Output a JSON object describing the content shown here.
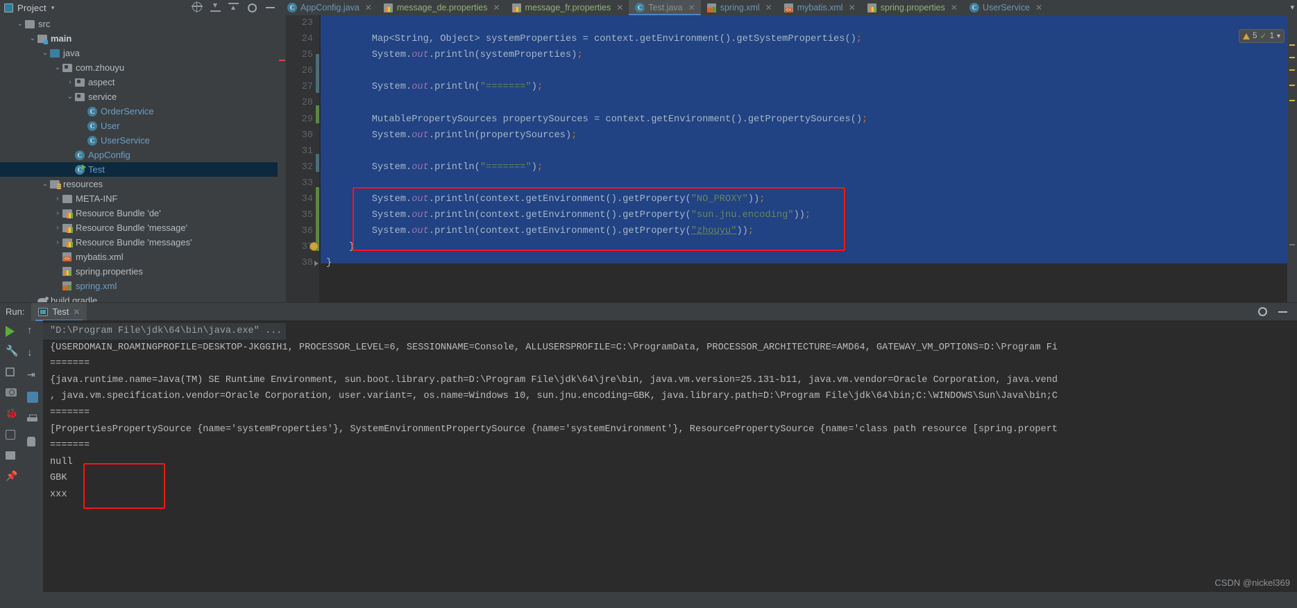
{
  "project_panel": {
    "title": "Project",
    "caret": "▾",
    "icons": [
      "project-window-icon",
      "locate-icon",
      "collapse-all-icon",
      "expand-all-icon"
    ],
    "tree": [
      {
        "indent": 1,
        "twist": "⌄",
        "icon": "folder-icon",
        "label": "src",
        "style": "plain"
      },
      {
        "indent": 2,
        "twist": "⌄",
        "icon": "source-folder-icon",
        "label": "main",
        "style": "bold"
      },
      {
        "indent": 3,
        "twist": "⌄",
        "icon": "java-folder-icon",
        "label": "java",
        "style": "plain"
      },
      {
        "indent": 4,
        "twist": "⌄",
        "icon": "package-icon",
        "label": "com.zhouyu",
        "style": "plain"
      },
      {
        "indent": 5,
        "twist": "›",
        "icon": "package-icon",
        "label": "aspect",
        "style": "plain"
      },
      {
        "indent": 5,
        "twist": "⌄",
        "icon": "package-icon",
        "label": "service",
        "style": "plain"
      },
      {
        "indent": 6,
        "twist": "",
        "icon": "java-class-icon",
        "label": "OrderService",
        "style": "blue"
      },
      {
        "indent": 6,
        "twist": "",
        "icon": "java-class-icon",
        "label": "User",
        "style": "blue"
      },
      {
        "indent": 6,
        "twist": "",
        "icon": "java-class-icon",
        "label": "UserService",
        "style": "blue"
      },
      {
        "indent": 5,
        "twist": "",
        "icon": "java-class-icon",
        "label": "AppConfig",
        "style": "blue"
      },
      {
        "indent": 5,
        "twist": "",
        "icon": "runnable-class-icon",
        "label": "Test",
        "style": "blue",
        "selected": true
      },
      {
        "indent": 3,
        "twist": "⌄",
        "icon": "resources-folder-icon",
        "label": "resources",
        "style": "plain"
      },
      {
        "indent": 4,
        "twist": "›",
        "icon": "folder-icon",
        "label": "META-INF",
        "style": "plain"
      },
      {
        "indent": 4,
        "twist": "›",
        "icon": "bundle-icon",
        "label": "Resource Bundle 'de'",
        "style": "plain"
      },
      {
        "indent": 4,
        "twist": "›",
        "icon": "bundle-icon",
        "label": "Resource Bundle 'message'",
        "style": "plain"
      },
      {
        "indent": 4,
        "twist": "›",
        "icon": "bundle-icon",
        "label": "Resource Bundle 'messages'",
        "style": "plain"
      },
      {
        "indent": 4,
        "twist": "",
        "icon": "xml-file-icon",
        "label": "mybatis.xml",
        "style": "plain"
      },
      {
        "indent": 4,
        "twist": "",
        "icon": "properties-file-icon",
        "label": "spring.properties",
        "style": "plain"
      },
      {
        "indent": 4,
        "twist": "",
        "icon": "spring-xml-icon",
        "label": "spring.xml",
        "style": "blue"
      },
      {
        "indent": 2,
        "twist": "",
        "icon": "gradle-icon",
        "label": "build.gradle",
        "style": "plain"
      }
    ]
  },
  "editor_tabs": [
    {
      "label": "AppConfig.java",
      "icon": "java-class-icon",
      "kind": "java",
      "active": false
    },
    {
      "label": "message_de.properties",
      "icon": "properties-file-icon",
      "kind": "props",
      "active": false
    },
    {
      "label": "message_fr.properties",
      "icon": "properties-file-icon",
      "kind": "props",
      "active": false
    },
    {
      "label": "Test.java",
      "icon": "java-class-icon",
      "kind": "java",
      "active": true
    },
    {
      "label": "spring.xml",
      "icon": "spring-xml-icon",
      "kind": "xml",
      "active": false
    },
    {
      "label": "mybatis.xml",
      "icon": "xml-file-icon",
      "kind": "xml",
      "active": false
    },
    {
      "label": "spring.properties",
      "icon": "properties-file-icon",
      "kind": "props",
      "active": false
    },
    {
      "label": "UserService",
      "icon": "java-class-icon",
      "kind": "java",
      "active": false
    }
  ],
  "editor_tabs_overflow_icon": "chevron-down-icon",
  "inspection_widget": {
    "warning_count": "5",
    "ok_count": "1",
    "warning_icon": "warning-triangle-icon",
    "ok_icon": "check-icon",
    "chevron_icon": "chevron-down-icon"
  },
  "editor": {
    "line_numbers": [
      "23",
      "24",
      "25",
      "26",
      "27",
      "28",
      "29",
      "30",
      "31",
      "32",
      "33",
      "34",
      "35",
      "36",
      "37",
      "38"
    ],
    "lines": [
      {
        "n": "23",
        "tokens": []
      },
      {
        "n": "24",
        "tokens": [
          {
            "t": "        Map<String, Object> systemProperties = context.getEnvironment().getSystemProperties()",
            "c": "n"
          },
          {
            "t": ";",
            "c": "semi"
          }
        ]
      },
      {
        "n": "25",
        "tokens": [
          {
            "t": "        System.",
            "c": "n"
          },
          {
            "t": "out",
            "c": "f"
          },
          {
            "t": ".println(systemProperties)",
            "c": "n"
          },
          {
            "t": ";",
            "c": "semi"
          }
        ]
      },
      {
        "n": "26",
        "tokens": []
      },
      {
        "n": "27",
        "tokens": [
          {
            "t": "        System.",
            "c": "n"
          },
          {
            "t": "out",
            "c": "f"
          },
          {
            "t": ".println(",
            "c": "n"
          },
          {
            "t": "\"=======\"",
            "c": "s"
          },
          {
            "t": ")",
            "c": "n"
          },
          {
            "t": ";",
            "c": "semi"
          }
        ]
      },
      {
        "n": "28",
        "tokens": []
      },
      {
        "n": "29",
        "tokens": [
          {
            "t": "        MutablePropertySources propertySources = context.getEnvironment().getPropertySources()",
            "c": "n"
          },
          {
            "t": ";",
            "c": "semi"
          }
        ]
      },
      {
        "n": "30",
        "tokens": [
          {
            "t": "        System.",
            "c": "n"
          },
          {
            "t": "out",
            "c": "f"
          },
          {
            "t": ".println(propertySources)",
            "c": "n"
          },
          {
            "t": ";",
            "c": "semi"
          }
        ]
      },
      {
        "n": "31",
        "tokens": []
      },
      {
        "n": "32",
        "tokens": [
          {
            "t": "        System.",
            "c": "n"
          },
          {
            "t": "out",
            "c": "f"
          },
          {
            "t": ".println(",
            "c": "n"
          },
          {
            "t": "\"=======\"",
            "c": "s"
          },
          {
            "t": ")",
            "c": "n"
          },
          {
            "t": ";",
            "c": "semi"
          }
        ]
      },
      {
        "n": "33",
        "tokens": []
      },
      {
        "n": "34",
        "tokens": [
          {
            "t": "        System.",
            "c": "n"
          },
          {
            "t": "out",
            "c": "f"
          },
          {
            "t": ".println(context.getEnvironment().getProperty(",
            "c": "n"
          },
          {
            "t": "\"NO_PROXY\"",
            "c": "s"
          },
          {
            "t": "))",
            "c": "n"
          },
          {
            "t": ";",
            "c": "semi"
          }
        ]
      },
      {
        "n": "35",
        "tokens": [
          {
            "t": "        System.",
            "c": "n"
          },
          {
            "t": "out",
            "c": "f"
          },
          {
            "t": ".println(context.getEnvironment().getProperty(",
            "c": "n"
          },
          {
            "t": "\"sun.jnu.encoding\"",
            "c": "s"
          },
          {
            "t": "))",
            "c": "n"
          },
          {
            "t": ";",
            "c": "semi"
          }
        ]
      },
      {
        "n": "36",
        "tokens": [
          {
            "t": "        System.",
            "c": "n"
          },
          {
            "t": "out",
            "c": "f"
          },
          {
            "t": ".println(context.getEnvironment().getProperty(",
            "c": "n"
          },
          {
            "t": "\"zhouyu\"",
            "c": "s u"
          },
          {
            "t": "))",
            "c": "n"
          },
          {
            "t": ";",
            "c": "semi"
          }
        ]
      },
      {
        "n": "37",
        "tokens": [
          {
            "t": "    }",
            "c": "n"
          }
        ]
      },
      {
        "n": "38",
        "tokens": [
          {
            "t": "}",
            "c": "n"
          }
        ]
      }
    ],
    "highlight_box_label": "code-highlight-box"
  },
  "run_panel": {
    "label": "Run:",
    "tab_label": "Test",
    "tab_close_icon": "close-icon",
    "tab_icon": "run-window-icon",
    "settings_icon": "gear-icon",
    "minimize_icon": "minimize-icon",
    "toolbar_left": [
      "rerun-icon",
      "wrench-icon",
      "stop-icon",
      "screenshot-icon",
      "debug-icon",
      "export-icon",
      "grid-icon",
      "pin-icon"
    ],
    "toolbar_right": [
      "scroll-up-icon",
      "scroll-down-icon",
      "soft-wrap-icon",
      "scroll-to-end-icon",
      "print-icon",
      "clear-all-icon"
    ],
    "console_lines": [
      {
        "text": "\"D:\\Program File\\jdk\\64\\bin\\java.exe\" ...",
        "style": "cmd"
      },
      {
        "text": "{USERDOMAIN_ROAMINGPROFILE=DESKTOP-JKGGIH1, PROCESSOR_LEVEL=6, SESSIONNAME=Console, ALLUSERSPROFILE=C:\\ProgramData, PROCESSOR_ARCHITECTURE=AMD64, GATEWAY_VM_OPTIONS=D:\\Program Fi",
        "style": "plain"
      },
      {
        "text": "=======",
        "style": "plain"
      },
      {
        "text": "{java.runtime.name=Java(TM) SE Runtime Environment, sun.boot.library.path=D:\\Program File\\jdk\\64\\jre\\bin, java.vm.version=25.131-b11, java.vm.vendor=Oracle Corporation, java.vend",
        "style": "plain"
      },
      {
        "text": ", java.vm.specification.vendor=Oracle Corporation, user.variant=, os.name=Windows 10, sun.jnu.encoding=GBK, java.library.path=D:\\Program File\\jdk\\64\\bin;C:\\WINDOWS\\Sun\\Java\\bin;C",
        "style": "plain"
      },
      {
        "text": "=======",
        "style": "plain"
      },
      {
        "text": "[PropertiesPropertySource {name='systemProperties'}, SystemEnvironmentPropertySource {name='systemEnvironment'}, ResourcePropertySource {name='class path resource [spring.propert",
        "style": "plain"
      },
      {
        "text": "=======",
        "style": "plain"
      },
      {
        "text": "null",
        "style": "plain"
      },
      {
        "text": "GBK",
        "style": "plain"
      },
      {
        "text": "xxx",
        "style": "plain"
      }
    ],
    "output_box_label": "console-highlight-box"
  },
  "watermark": "CSDN @nickel369",
  "colors": {
    "accent_blue": "#4a88c7",
    "selection_blue": "#214283",
    "highlight_red": "#fb1414",
    "editor_bg": "#2b2b2b",
    "panel_bg": "#3c3f41",
    "string_green": "#6a8759",
    "field_purple": "#9876aa"
  }
}
